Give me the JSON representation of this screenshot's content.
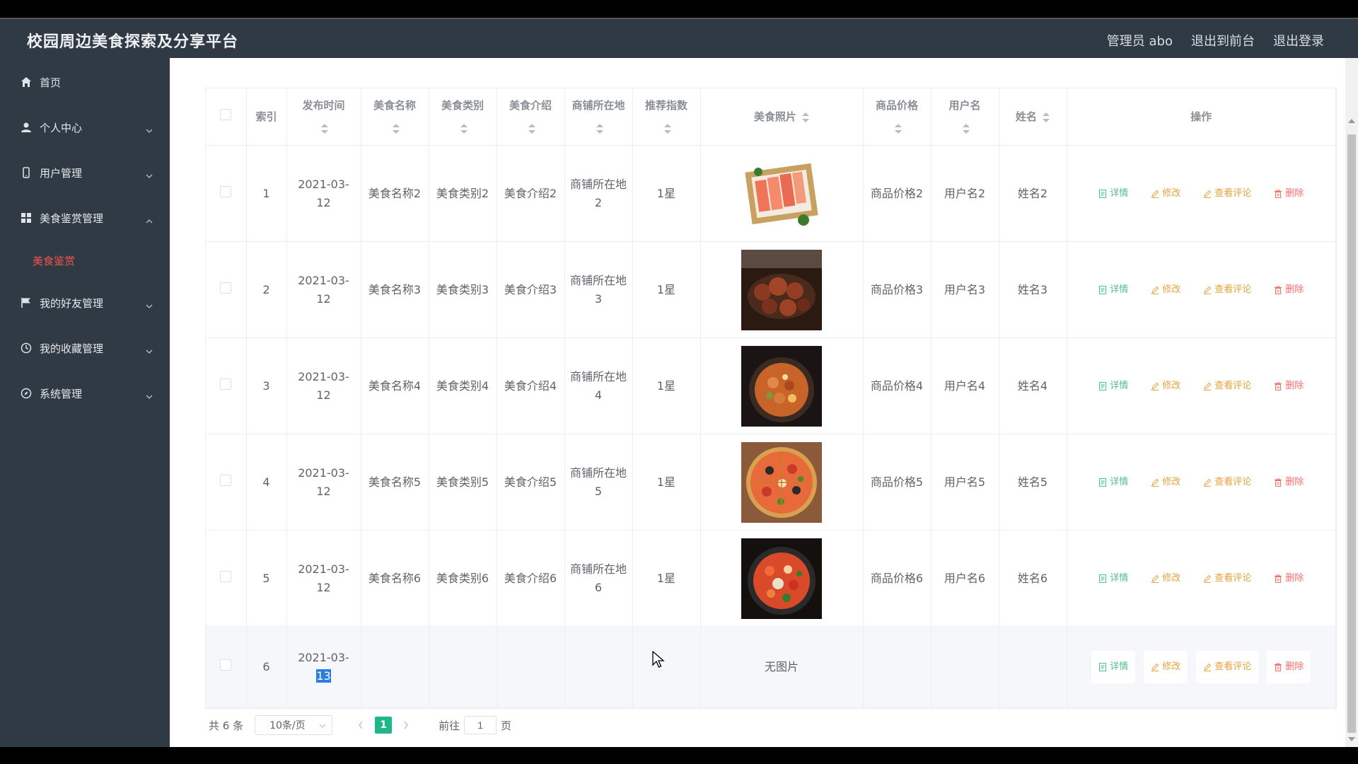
{
  "header": {
    "title": "校园周边美食探索及分享平台",
    "admin": "管理员 abo",
    "to_front": "退出到前台",
    "logout": "退出登录"
  },
  "sidebar": {
    "items": [
      {
        "label": "首页",
        "icon": "home-icon"
      },
      {
        "label": "个人中心",
        "icon": "user-icon"
      },
      {
        "label": "用户管理",
        "icon": "phone-icon"
      },
      {
        "label": "美食鉴赏管理",
        "icon": "grid-icon"
      },
      {
        "label": "我的好友管理",
        "icon": "flag-icon"
      },
      {
        "label": "我的收藏管理",
        "icon": "clock-icon"
      },
      {
        "label": "系统管理",
        "icon": "compass-icon"
      }
    ],
    "active_sub": "美食鉴赏"
  },
  "table": {
    "headers": {
      "index": "索引",
      "time": "发布时间",
      "name": "美食名称",
      "category": "美食类别",
      "intro": "美食介绍",
      "location": "商铺所在地",
      "rating": "推荐指数",
      "photo": "美食照片",
      "price": "商品价格",
      "username": "用户名",
      "realname": "姓名",
      "actions": "操作"
    },
    "rows": [
      {
        "index": "1",
        "time": "2021-03-12",
        "name": "美食名称2",
        "category": "美食类别2",
        "intro": "美食介绍2",
        "location": "商铺所在地2",
        "rating": "1星",
        "price": "商品价格2",
        "username": "用户名2",
        "realname": "姓名2"
      },
      {
        "index": "2",
        "time": "2021-03-12",
        "name": "美食名称3",
        "category": "美食类别3",
        "intro": "美食介绍3",
        "location": "商铺所在地3",
        "rating": "1星",
        "price": "商品价格3",
        "username": "用户名3",
        "realname": "姓名3"
      },
      {
        "index": "3",
        "time": "2021-03-12",
        "name": "美食名称4",
        "category": "美食类别4",
        "intro": "美食介绍4",
        "location": "商铺所在地4",
        "rating": "1星",
        "price": "商品价格4",
        "username": "用户名4",
        "realname": "姓名4"
      },
      {
        "index": "4",
        "time": "2021-03-12",
        "name": "美食名称5",
        "category": "美食类别5",
        "intro": "美食介绍5",
        "location": "商铺所在地5",
        "rating": "1星",
        "price": "商品价格5",
        "username": "用户名5",
        "realname": "姓名5"
      },
      {
        "index": "5",
        "time": "2021-03-12",
        "name": "美食名称6",
        "category": "美食类别6",
        "intro": "美食介绍6",
        "location": "商铺所在地6",
        "rating": "1星",
        "price": "商品价格6",
        "username": "用户名6",
        "realname": "姓名6"
      }
    ],
    "last_row": {
      "index": "6",
      "time_prefix": "2021-03-",
      "time_selected": "13",
      "photo_text": "无图片"
    },
    "actions": {
      "detail": "详情",
      "edit": "修改",
      "comments": "查看评论",
      "delete": "删除"
    }
  },
  "pager": {
    "total": "共 6 条",
    "page_size": "10条/页",
    "current": "1",
    "goto_label": "前往",
    "goto_value": "1",
    "page_unit": "页"
  },
  "colors": {
    "sidebar_bg": "#2f3a45",
    "active": "#f0534d",
    "green": "#4fc08d",
    "yellow": "#e6a23c",
    "red": "#f56c6c",
    "pager_active": "#1fb785"
  }
}
